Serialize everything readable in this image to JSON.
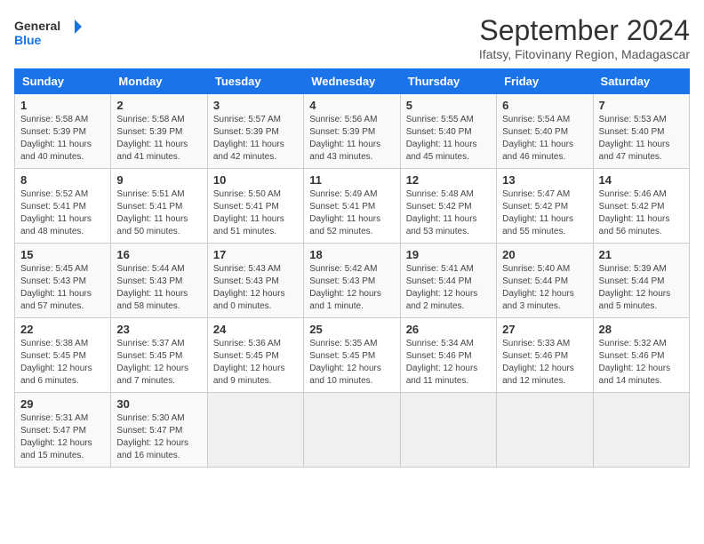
{
  "header": {
    "logo_line1": "General",
    "logo_line2": "Blue",
    "main_title": "September 2024",
    "subtitle": "Ifatsy, Fitovinany Region, Madagascar"
  },
  "days_of_week": [
    "Sunday",
    "Monday",
    "Tuesday",
    "Wednesday",
    "Thursday",
    "Friday",
    "Saturday"
  ],
  "weeks": [
    [
      {
        "day": "1",
        "info": "Sunrise: 5:58 AM\nSunset: 5:39 PM\nDaylight: 11 hours\nand 40 minutes."
      },
      {
        "day": "2",
        "info": "Sunrise: 5:58 AM\nSunset: 5:39 PM\nDaylight: 11 hours\nand 41 minutes."
      },
      {
        "day": "3",
        "info": "Sunrise: 5:57 AM\nSunset: 5:39 PM\nDaylight: 11 hours\nand 42 minutes."
      },
      {
        "day": "4",
        "info": "Sunrise: 5:56 AM\nSunset: 5:39 PM\nDaylight: 11 hours\nand 43 minutes."
      },
      {
        "day": "5",
        "info": "Sunrise: 5:55 AM\nSunset: 5:40 PM\nDaylight: 11 hours\nand 45 minutes."
      },
      {
        "day": "6",
        "info": "Sunrise: 5:54 AM\nSunset: 5:40 PM\nDaylight: 11 hours\nand 46 minutes."
      },
      {
        "day": "7",
        "info": "Sunrise: 5:53 AM\nSunset: 5:40 PM\nDaylight: 11 hours\nand 47 minutes."
      }
    ],
    [
      {
        "day": "8",
        "info": "Sunrise: 5:52 AM\nSunset: 5:41 PM\nDaylight: 11 hours\nand 48 minutes."
      },
      {
        "day": "9",
        "info": "Sunrise: 5:51 AM\nSunset: 5:41 PM\nDaylight: 11 hours\nand 50 minutes."
      },
      {
        "day": "10",
        "info": "Sunrise: 5:50 AM\nSunset: 5:41 PM\nDaylight: 11 hours\nand 51 minutes."
      },
      {
        "day": "11",
        "info": "Sunrise: 5:49 AM\nSunset: 5:41 PM\nDaylight: 11 hours\nand 52 minutes."
      },
      {
        "day": "12",
        "info": "Sunrise: 5:48 AM\nSunset: 5:42 PM\nDaylight: 11 hours\nand 53 minutes."
      },
      {
        "day": "13",
        "info": "Sunrise: 5:47 AM\nSunset: 5:42 PM\nDaylight: 11 hours\nand 55 minutes."
      },
      {
        "day": "14",
        "info": "Sunrise: 5:46 AM\nSunset: 5:42 PM\nDaylight: 11 hours\nand 56 minutes."
      }
    ],
    [
      {
        "day": "15",
        "info": "Sunrise: 5:45 AM\nSunset: 5:43 PM\nDaylight: 11 hours\nand 57 minutes."
      },
      {
        "day": "16",
        "info": "Sunrise: 5:44 AM\nSunset: 5:43 PM\nDaylight: 11 hours\nand 58 minutes."
      },
      {
        "day": "17",
        "info": "Sunrise: 5:43 AM\nSunset: 5:43 PM\nDaylight: 12 hours\nand 0 minutes."
      },
      {
        "day": "18",
        "info": "Sunrise: 5:42 AM\nSunset: 5:43 PM\nDaylight: 12 hours\nand 1 minute."
      },
      {
        "day": "19",
        "info": "Sunrise: 5:41 AM\nSunset: 5:44 PM\nDaylight: 12 hours\nand 2 minutes."
      },
      {
        "day": "20",
        "info": "Sunrise: 5:40 AM\nSunset: 5:44 PM\nDaylight: 12 hours\nand 3 minutes."
      },
      {
        "day": "21",
        "info": "Sunrise: 5:39 AM\nSunset: 5:44 PM\nDaylight: 12 hours\nand 5 minutes."
      }
    ],
    [
      {
        "day": "22",
        "info": "Sunrise: 5:38 AM\nSunset: 5:45 PM\nDaylight: 12 hours\nand 6 minutes."
      },
      {
        "day": "23",
        "info": "Sunrise: 5:37 AM\nSunset: 5:45 PM\nDaylight: 12 hours\nand 7 minutes."
      },
      {
        "day": "24",
        "info": "Sunrise: 5:36 AM\nSunset: 5:45 PM\nDaylight: 12 hours\nand 9 minutes."
      },
      {
        "day": "25",
        "info": "Sunrise: 5:35 AM\nSunset: 5:45 PM\nDaylight: 12 hours\nand 10 minutes."
      },
      {
        "day": "26",
        "info": "Sunrise: 5:34 AM\nSunset: 5:46 PM\nDaylight: 12 hours\nand 11 minutes."
      },
      {
        "day": "27",
        "info": "Sunrise: 5:33 AM\nSunset: 5:46 PM\nDaylight: 12 hours\nand 12 minutes."
      },
      {
        "day": "28",
        "info": "Sunrise: 5:32 AM\nSunset: 5:46 PM\nDaylight: 12 hours\nand 14 minutes."
      }
    ],
    [
      {
        "day": "29",
        "info": "Sunrise: 5:31 AM\nSunset: 5:47 PM\nDaylight: 12 hours\nand 15 minutes."
      },
      {
        "day": "30",
        "info": "Sunrise: 5:30 AM\nSunset: 5:47 PM\nDaylight: 12 hours\nand 16 minutes."
      },
      {
        "day": "",
        "info": ""
      },
      {
        "day": "",
        "info": ""
      },
      {
        "day": "",
        "info": ""
      },
      {
        "day": "",
        "info": ""
      },
      {
        "day": "",
        "info": ""
      }
    ]
  ]
}
